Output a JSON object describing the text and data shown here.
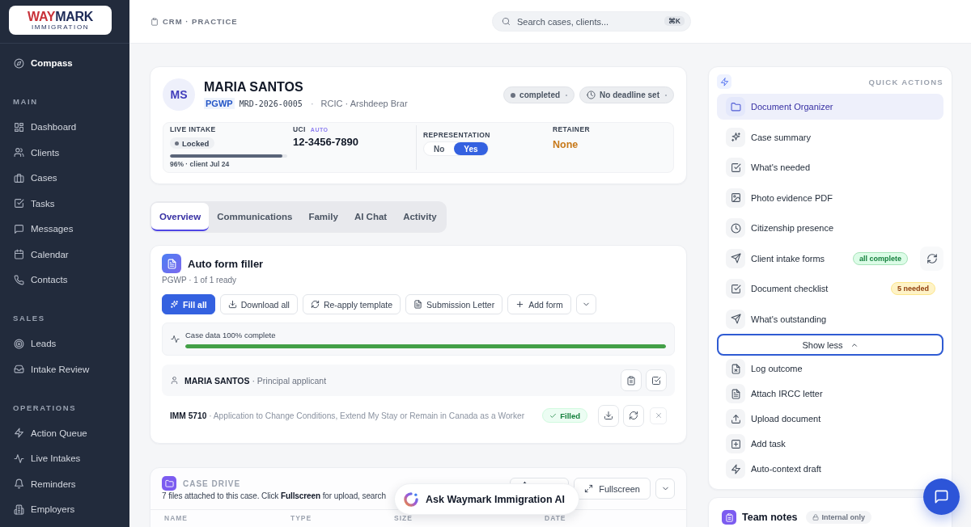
{
  "sidebar": {
    "brand": [
      "WAY",
      "MARK"
    ],
    "tagline": "IMMIGRATION",
    "home_item": {
      "label": "Compass"
    },
    "sections": [
      {
        "heading": "MAIN",
        "items": [
          {
            "label": "Dashboard"
          },
          {
            "label": "Clients"
          },
          {
            "label": "Cases"
          },
          {
            "label": "Tasks"
          },
          {
            "label": "Messages"
          },
          {
            "label": "Calendar"
          },
          {
            "label": "Contacts"
          }
        ]
      },
      {
        "heading": "SALES",
        "items": [
          {
            "label": "Leads"
          },
          {
            "label": "Intake Review"
          }
        ]
      },
      {
        "heading": "OPERATIONS",
        "items": [
          {
            "label": "Action Queue"
          },
          {
            "label": "Live Intakes"
          },
          {
            "label": "Reminders"
          },
          {
            "label": "Employers"
          }
        ]
      }
    ]
  },
  "top_bar": {
    "breadcrumb": "CRM · PRACTICE",
    "search": {
      "placeholder": "Search cases, clients...",
      "shortcut": "⌘K"
    }
  },
  "client": {
    "initials": "MS",
    "name": "MARIA SANTOS",
    "program": "PGWP",
    "file_number": "MRD-2026-0005",
    "separator": "·",
    "representative": "RCIC · Arshdeep Brar",
    "status": "completed",
    "deadline": "No deadline set",
    "live_intake": {
      "label": "LIVE INTAKE",
      "status": "Locked",
      "level": 0.96,
      "caption": "96% · client Jul 24"
    },
    "uci": {
      "label": "UCI",
      "tag": "AUTO",
      "value": "12-3456-7890"
    },
    "representation": {
      "label": "REPRESENTATION",
      "options": [
        {
          "label": "No",
          "selected": false
        },
        {
          "label": "Yes",
          "selected": true
        }
      ]
    },
    "retainer": {
      "label": "RETAINER",
      "value": "None"
    }
  },
  "tabs": [
    {
      "label": "Overview",
      "selected": true
    },
    {
      "label": "Communications",
      "selected": false
    },
    {
      "label": "Family",
      "selected": false
    },
    {
      "label": "AI Chat",
      "selected": false
    },
    {
      "label": "Activity",
      "selected": false
    }
  ],
  "form_filler": {
    "title": "Auto form filler",
    "subtitle": "PGWP · 1 of 1 ready",
    "actions": [
      {
        "label": "Fill all",
        "kind": "primary"
      },
      {
        "label": "Download all",
        "kind": "secondary"
      },
      {
        "label": "Re-apply template",
        "kind": "secondary"
      },
      {
        "label": "Submission Letter",
        "kind": "secondary"
      },
      {
        "label": "Add form",
        "kind": "secondary"
      },
      {
        "kind": "menu"
      }
    ],
    "completeness": {
      "label": "Case data 100% complete",
      "level": 1
    },
    "applicant": "**MARIA SANTOS** · Principal applicant",
    "forms": [
      {
        "text": "**IMM 5710** · Application to Change Conditions, Extend My Stay or Remain in Canada as a Worker",
        "status": "Filled"
      }
    ]
  },
  "case_drive": {
    "title": "CASE DRIVE",
    "description": "7 files attached to this case. Click **Fullscreen** for upload, search",
    "actions": [
      {
        "kind": "icon"
      },
      {
        "label": "Fullscreen",
        "kind": "secondary"
      },
      {
        "kind": "menu"
      }
    ],
    "columns": [
      "NAME",
      "TYPE",
      "SIZE",
      "DATE"
    ]
  },
  "assistant": {
    "label": "Ask Waymark Immigration AI"
  },
  "quick_actions": {
    "title": "QUICK ACTIONS",
    "items": [
      {
        "label": "Document Organizer",
        "selected": true,
        "kind": "plain"
      },
      {
        "label": "Case summary",
        "selected": false,
        "kind": "plain"
      },
      {
        "label": "What's needed",
        "selected": false,
        "kind": "plain"
      },
      {
        "label": "Photo evidence PDF",
        "selected": false,
        "kind": "plain"
      },
      {
        "label": "Citizenship presence",
        "selected": false,
        "kind": "plain"
      },
      {
        "label": "Client intake forms",
        "selected": false,
        "kind": "badge_refresh",
        "badge": {
          "label": "all complete",
          "kind": "success"
        }
      },
      {
        "label": "Document checklist",
        "selected": false,
        "kind": "badge",
        "badge": {
          "label": "5 needed",
          "kind": "warning"
        }
      },
      {
        "label": "What's outstanding",
        "selected": false,
        "kind": "plain"
      }
    ],
    "toggle": {
      "label": "Show less",
      "expanded": true
    },
    "more_items": [
      {
        "label": "Log outcome"
      },
      {
        "label": "Attach IRCC letter"
      },
      {
        "label": "Upload document"
      },
      {
        "label": "Add task"
      },
      {
        "label": "Auto-context draft"
      }
    ]
  },
  "team_notes": {
    "title": "Team notes",
    "tag": "Internal only"
  }
}
